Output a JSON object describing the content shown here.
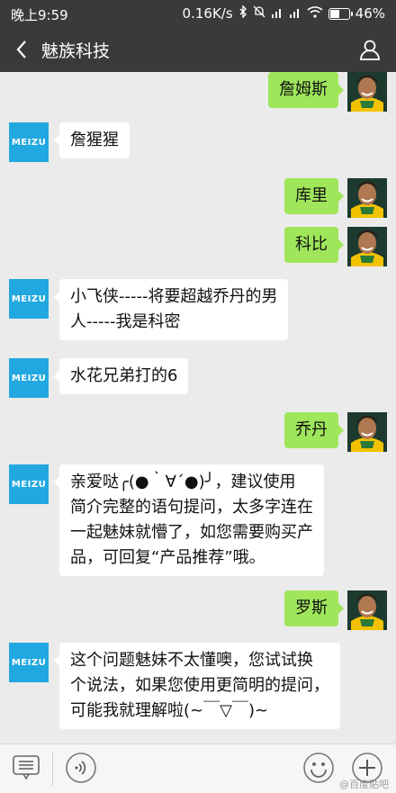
{
  "status_bar": {
    "time": "晚上9:59",
    "speed": "0.16K/s",
    "battery": "46%",
    "battery_level": 0.46
  },
  "header": {
    "title": "魅族科技"
  },
  "avatar_brand_text": "MEIZU",
  "messages": [
    {
      "side": "right",
      "text": "詹姆斯"
    },
    {
      "side": "left",
      "text": "詹猩猩"
    },
    {
      "side": "right",
      "text": "库里"
    },
    {
      "side": "right",
      "text": "科比"
    },
    {
      "side": "left",
      "lines": [
        "小飞侠-----将要超越乔丹的男",
        "人-----我是科密"
      ]
    },
    {
      "side": "left",
      "text": "水花兄弟打的6"
    },
    {
      "side": "right",
      "text": "乔丹"
    },
    {
      "side": "left",
      "lines": [
        "亲爱哒╭(●｀∀´●)╯，建议使用",
        "简介完整的语句提问，太多字连在",
        "一起魅妹就懵了，如您需要购买产",
        "品，可回复“产品推荐”哦。"
      ]
    },
    {
      "side": "right",
      "text": "罗斯"
    },
    {
      "side": "left",
      "lines": [
        "这个问题魅妹不太懂噢，您试试换",
        "个说法，如果您使用更简明的提问，",
        "可能我就理解啦(~￣▽￣)~"
      ]
    }
  ],
  "watermark": "@百度贴吧",
  "colors": {
    "bar": "#3a3a3a",
    "right_bubble": "#9fe65a",
    "meizu_avatar": "#22a8e0"
  }
}
